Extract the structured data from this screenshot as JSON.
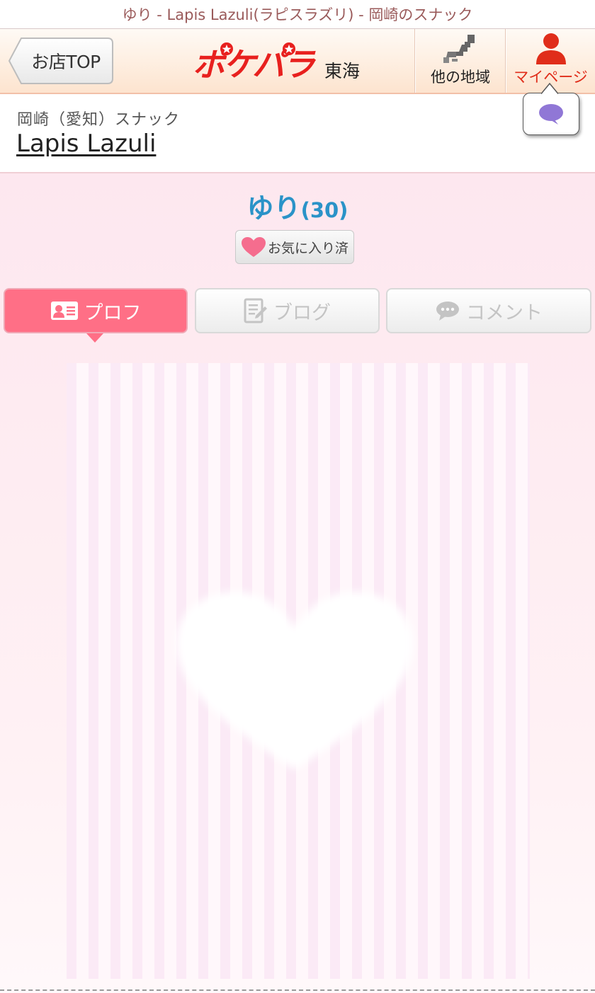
{
  "page_title": "ゆり - Lapis Lazuli(ラピスラズリ) - 岡崎のスナック",
  "header": {
    "back_label": "お店TOP",
    "logo_text": "ポケパラ",
    "region_name": "東海",
    "other_region_label": "他の地域",
    "mypage_label": "マイページ"
  },
  "shop": {
    "category": "岡崎（愛知）スナック",
    "name": "Lapis Lazuli"
  },
  "profile": {
    "name": "ゆり",
    "age": "(30)",
    "favorite_label": "お気に入り済"
  },
  "tabs": [
    {
      "label": "プロフ",
      "icon": "profile-card-icon",
      "active": true
    },
    {
      "label": "ブログ",
      "icon": "blog-memo-icon",
      "active": false
    },
    {
      "label": "コメント",
      "icon": "comment-bubble-icon",
      "active": false
    }
  ],
  "colors": {
    "accent_pink": "#ff6f86",
    "name_blue": "#2a93c8",
    "mypage_red": "#e02d1a",
    "header_bg": "#fde4cf"
  }
}
